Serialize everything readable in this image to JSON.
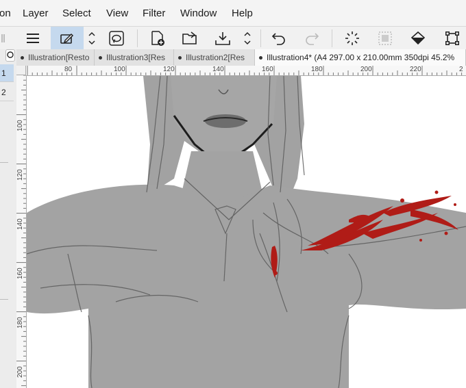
{
  "menu": [
    "on",
    "Layer",
    "Select",
    "View",
    "Filter",
    "Window",
    "Help"
  ],
  "toolbar": {
    "icons": [
      "menu-icon",
      "pen-tool-icon",
      "chevron-updown-icon",
      "lasso-icon",
      "new-file-icon",
      "open-folder-icon",
      "save-icon",
      "chevron-updown-icon",
      "undo-icon",
      "redo-icon",
      "loading-spinner-icon",
      "select-all-icon",
      "fill-icon",
      "transform-icon"
    ]
  },
  "left_panel": {
    "tabs": [
      "1",
      "2"
    ]
  },
  "tabs": [
    {
      "label": "Illustration[Resto",
      "active": false
    },
    {
      "label": "Illustration3[Res",
      "active": false
    },
    {
      "label": "Illustration2[Res",
      "active": false
    },
    {
      "label": "Illustration4* (A4 297.00 x 210.00mm 350dpi 45.2%",
      "active": true
    }
  ],
  "ruler_top": [
    "80",
    "100",
    "120",
    "140",
    "160",
    "180",
    "200",
    "220",
    "2"
  ],
  "ruler_left": [
    "100",
    "120",
    "140",
    "160",
    "180",
    "200"
  ],
  "colors": {
    "accent": "#c5d9ee",
    "figure_gray": "#a3a3a3",
    "blood_red": "#b01c17"
  }
}
